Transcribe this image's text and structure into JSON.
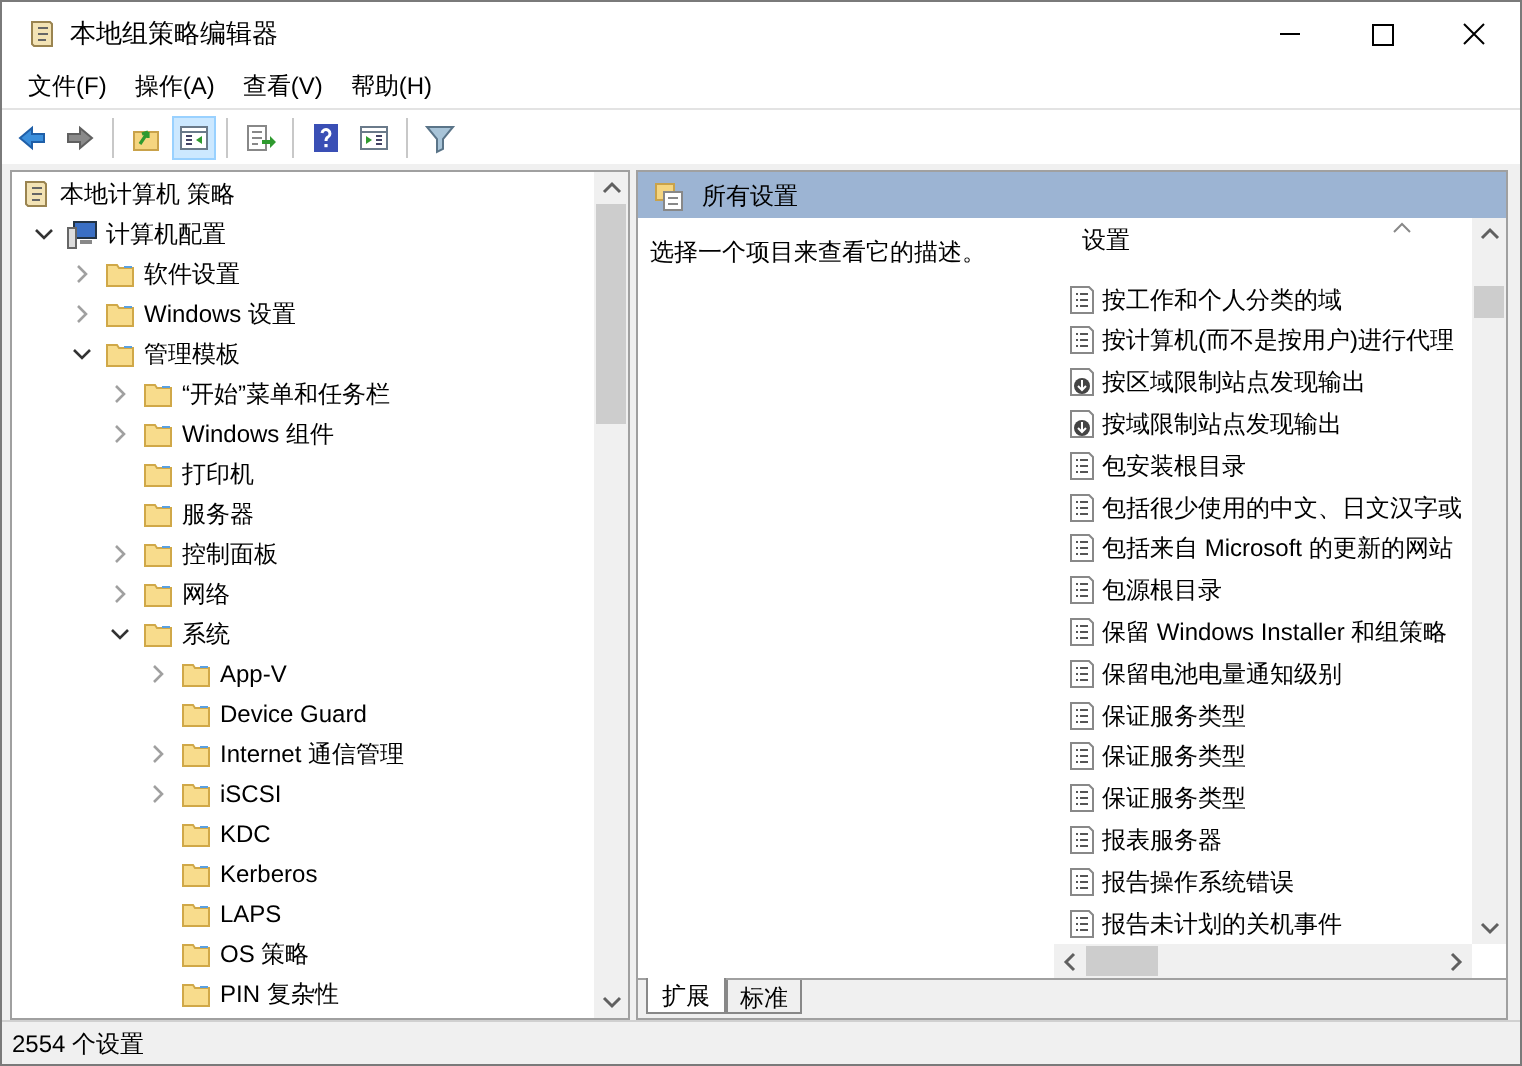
{
  "window": {
    "title": "本地组策略编辑器"
  },
  "menu": [
    "文件(F)",
    "操作(A)",
    "查看(V)",
    "帮助(H)"
  ],
  "toolbar": [
    {
      "kind": "back",
      "selected": false
    },
    {
      "kind": "forward",
      "selected": false
    },
    {
      "kind": "sep"
    },
    {
      "kind": "up",
      "selected": false
    },
    {
      "kind": "tree",
      "selected": true
    },
    {
      "kind": "sep"
    },
    {
      "kind": "export",
      "selected": false
    },
    {
      "kind": "sep"
    },
    {
      "kind": "help",
      "selected": false
    },
    {
      "kind": "pane",
      "selected": false
    },
    {
      "kind": "sep"
    },
    {
      "kind": "filter",
      "selected": false
    }
  ],
  "tree": [
    {
      "label": "本地计算机 策略",
      "kind": "policy",
      "children": [
        {
          "label": "计算机配置",
          "kind": "computer",
          "expanded": true,
          "children": [
            {
              "label": "软件设置",
              "kind": "folder",
              "expanded": false
            },
            {
              "label": "Windows 设置",
              "kind": "folder",
              "expanded": false
            },
            {
              "label": "管理模板",
              "kind": "folder",
              "expanded": true,
              "children": [
                {
                  "label": "“开始”菜单和任务栏",
                  "kind": "folder",
                  "expanded": false
                },
                {
                  "label": "Windows 组件",
                  "kind": "folder",
                  "expanded": false
                },
                {
                  "label": "打印机",
                  "kind": "folder"
                },
                {
                  "label": "服务器",
                  "kind": "folder"
                },
                {
                  "label": "控制面板",
                  "kind": "folder",
                  "expanded": false
                },
                {
                  "label": "网络",
                  "kind": "folder",
                  "expanded": false
                },
                {
                  "label": "系统",
                  "kind": "folder",
                  "expanded": true,
                  "children": [
                    {
                      "label": "App-V",
                      "kind": "folder",
                      "expanded": false
                    },
                    {
                      "label": "Device Guard",
                      "kind": "folder"
                    },
                    {
                      "label": "Internet 通信管理",
                      "kind": "folder",
                      "expanded": false
                    },
                    {
                      "label": "iSCSI",
                      "kind": "folder",
                      "expanded": false
                    },
                    {
                      "label": "KDC",
                      "kind": "folder"
                    },
                    {
                      "label": "Kerberos",
                      "kind": "folder"
                    },
                    {
                      "label": "LAPS",
                      "kind": "folder"
                    },
                    {
                      "label": "OS 策略",
                      "kind": "folder"
                    },
                    {
                      "label": "PIN 复杂性",
                      "kind": "folder"
                    }
                  ]
                }
              ]
            }
          ]
        }
      ]
    }
  ],
  "header": {
    "title": "所有设置"
  },
  "description": "选择一个项目来查看它的描述。",
  "settings": {
    "column": "设置",
    "rows": [
      {
        "label": "按工作和个人分类的域",
        "kind": "setting"
      },
      {
        "label": "按计算机(而不是按用户)进行代理",
        "kind": "setting"
      },
      {
        "label": "按区域限制站点发现输出",
        "kind": "download"
      },
      {
        "label": "按域限制站点发现输出",
        "kind": "download"
      },
      {
        "label": "包安装根目录",
        "kind": "setting"
      },
      {
        "label": "包括很少使用的中文、日文汉字或",
        "kind": "setting"
      },
      {
        "label": "包括来自 Microsoft 的更新的网站",
        "kind": "setting"
      },
      {
        "label": "包源根目录",
        "kind": "setting"
      },
      {
        "label": "保留 Windows Installer 和组策略",
        "kind": "setting"
      },
      {
        "label": "保留电池电量通知级别",
        "kind": "setting"
      },
      {
        "label": "保证服务类型",
        "kind": "setting"
      },
      {
        "label": "保证服务类型",
        "kind": "setting"
      },
      {
        "label": "保证服务类型",
        "kind": "setting"
      },
      {
        "label": "报表服务器",
        "kind": "setting"
      },
      {
        "label": "报告操作系统错误",
        "kind": "setting"
      },
      {
        "label": "报告未计划的关机事件",
        "kind": "setting"
      }
    ]
  },
  "tabs": [
    {
      "label": "扩展",
      "selected": true
    },
    {
      "label": "标准",
      "selected": false
    }
  ],
  "status_bar": "2554 个设置"
}
